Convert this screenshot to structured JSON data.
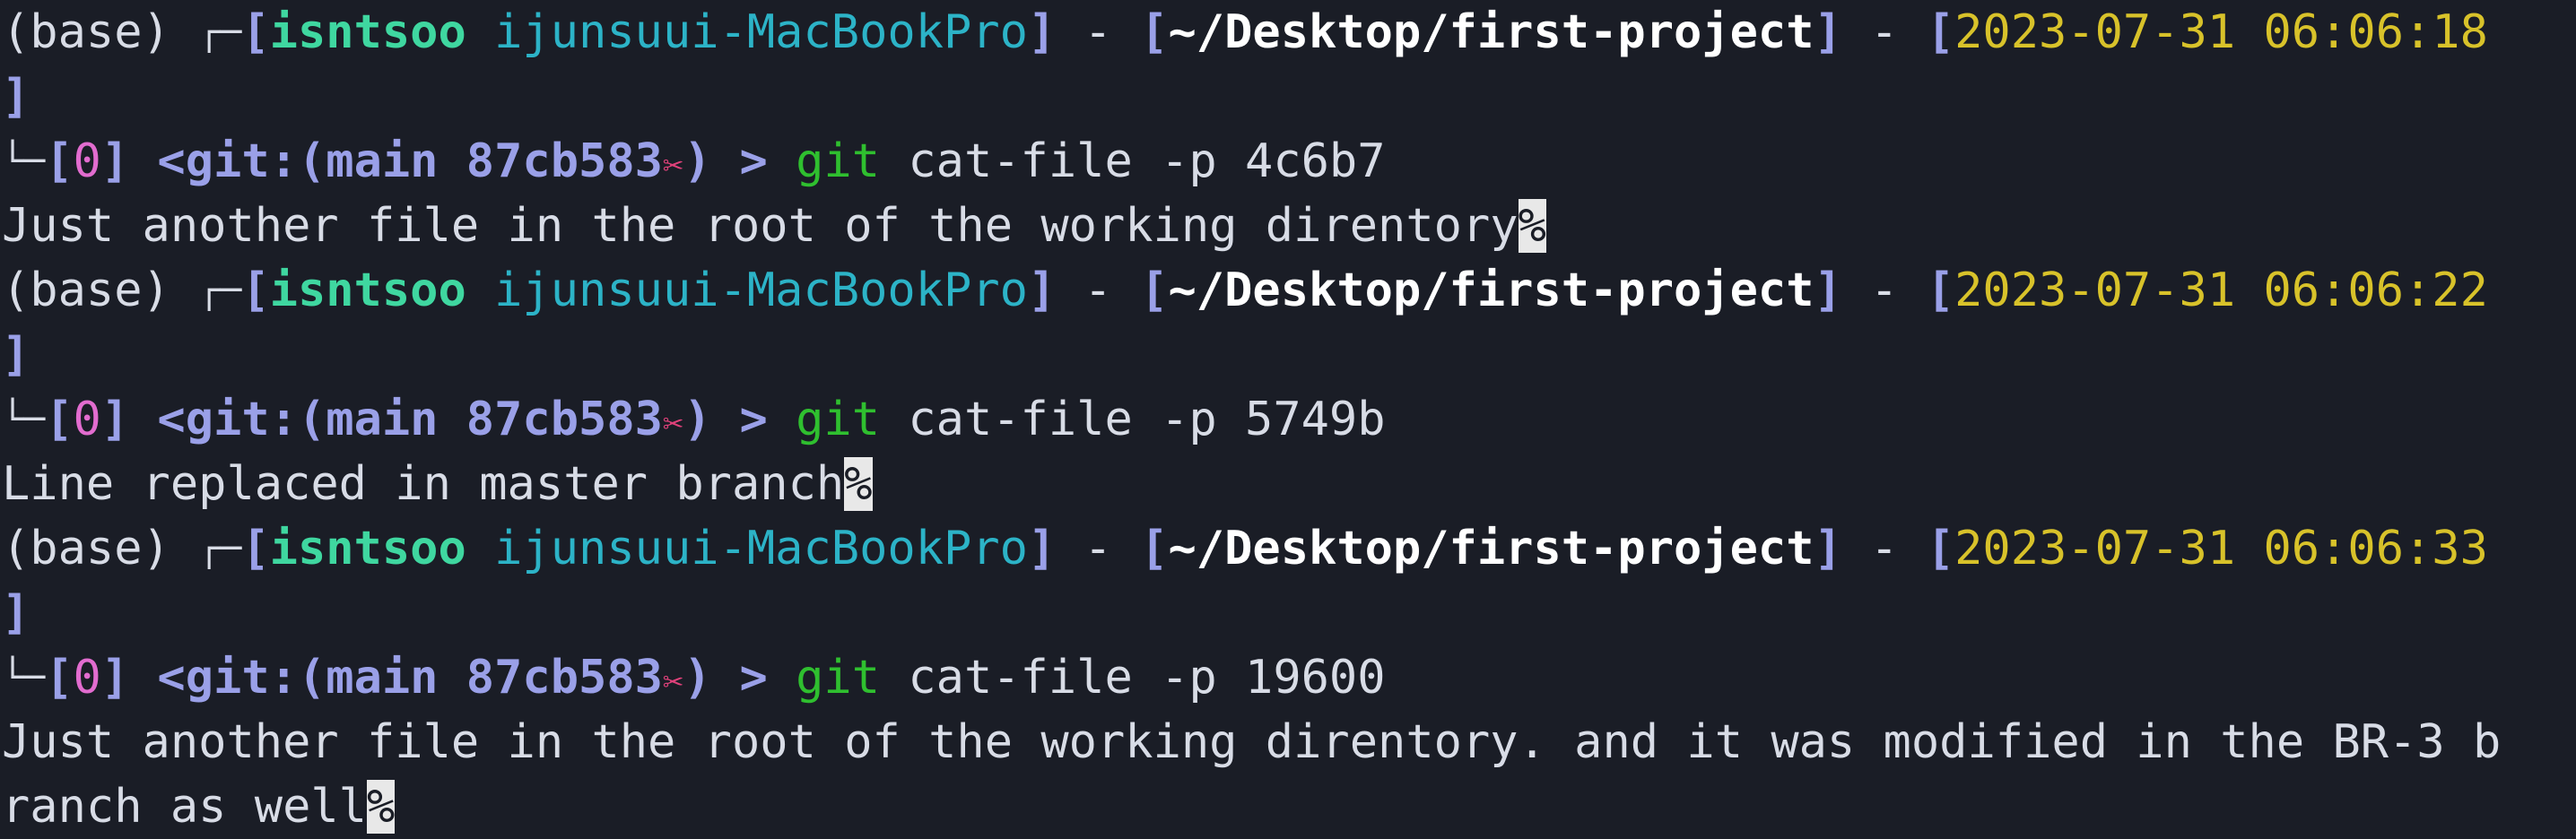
{
  "terminal": {
    "blocks": [
      {
        "prompt": {
          "env": "(base)",
          "user": "isntsoo",
          "host": "ijunsuui-MacBookPro",
          "cwd": "~/Desktop/first-project",
          "datetime": "2023-07-31 06:06:18",
          "exit_code": "0",
          "git_label": "<git:(main 87cb583",
          "git_dirty": "✂",
          "git_close": ")",
          "arrow": ">"
        },
        "command": {
          "program": "git",
          "args": "cat-file -p 4c6b7"
        },
        "output": [
          "Just another file in the root of the working direntory"
        ],
        "eol_marker": "%"
      },
      {
        "prompt": {
          "env": "(base)",
          "user": "isntsoo",
          "host": "ijunsuui-MacBookPro",
          "cwd": "~/Desktop/first-project",
          "datetime": "2023-07-31 06:06:22",
          "exit_code": "0",
          "git_label": "<git:(main 87cb583",
          "git_dirty": "✂",
          "git_close": ")",
          "arrow": ">"
        },
        "command": {
          "program": "git",
          "args": "cat-file -p 5749b"
        },
        "output": [
          "Line replaced in master branch"
        ],
        "eol_marker": "%"
      },
      {
        "prompt": {
          "env": "(base)",
          "user": "isntsoo",
          "host": "ijunsuui-MacBookPro",
          "cwd": "~/Desktop/first-project",
          "datetime": "2023-07-31 06:06:33",
          "exit_code": "0",
          "git_label": "<git:(main 87cb583",
          "git_dirty": "✂",
          "git_close": ")",
          "arrow": ">"
        },
        "command": {
          "program": "git",
          "args": "cat-file -p 19600"
        },
        "output": [
          "Just another file in the root of the working direntory. and it was modified in the BR-3 b",
          "ranch as well"
        ],
        "eol_marker": "%"
      }
    ]
  }
}
